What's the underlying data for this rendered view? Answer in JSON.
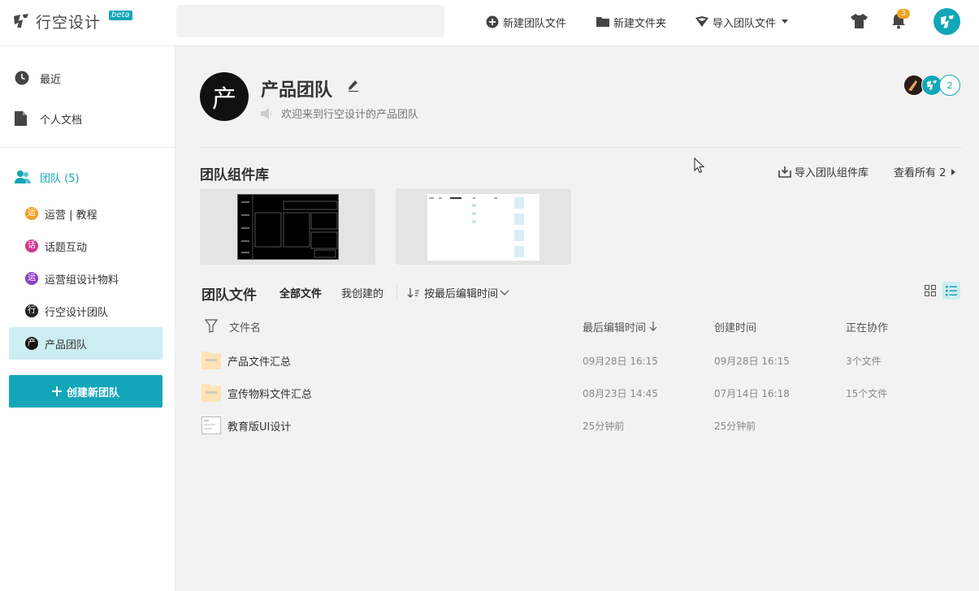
{
  "app": {
    "logo_text": "行空设计",
    "beta": "beta"
  },
  "search": {
    "placeholder": "",
    "value": ""
  },
  "toolbar": {
    "new_team_file": "新建团队文件",
    "new_folder": "新建文件夹",
    "import_team_file": "导入团队文件",
    "notification_count": "3",
    "icons": [
      "search-icon",
      "plus-circle-icon",
      "folder-icon",
      "import-icon",
      "caret-down-icon",
      "tshirt-icon",
      "bell-icon",
      "user-avatar"
    ]
  },
  "sidebar": {
    "recent": "最近",
    "personal_docs": "个人文档",
    "teams_header": "团队 (5)",
    "teams": [
      {
        "label": "运营 | 教程",
        "glyph": "运",
        "color": "#f0a221"
      },
      {
        "label": "话题互动",
        "glyph": "话",
        "color": "#d6358f"
      },
      {
        "label": "运营组设计物料",
        "glyph": "运",
        "color": "#8a3fc6"
      },
      {
        "label": "行空设计团队",
        "glyph": "行",
        "color": "#222222"
      },
      {
        "label": "产品团队",
        "glyph": "产",
        "color": "#111111"
      }
    ],
    "active_team_index": 4,
    "create_team": "创建新团队"
  },
  "team": {
    "avatar_glyph": "产",
    "name": "产品团队",
    "welcome": "欢迎来到行空设计的产品团队",
    "extra_members_count": "2"
  },
  "library": {
    "title": "团队组件库",
    "import_label": "导入团队组件库",
    "view_all_label": "查看所有 2"
  },
  "files": {
    "title": "团队文件",
    "tabs": [
      "全部文件",
      "我创建的"
    ],
    "active_tab": 0,
    "sort_label": "按最后编辑时间",
    "columns": {
      "name": "文件名",
      "last_edited": "最后编辑时间",
      "created": "创建时间",
      "collaborating": "正在协作"
    },
    "rows": [
      {
        "type": "folder",
        "name": "产品文件汇总",
        "last_edited": "09月28日 16:15",
        "created": "09月28日 16:15",
        "collab": "3个文件"
      },
      {
        "type": "folder",
        "name": "宣传物料文件汇总",
        "last_edited": "08月23日 14:45",
        "created": "07月14日 16:18",
        "collab": "15个文件"
      },
      {
        "type": "file",
        "name": "教育版UI设计",
        "last_edited": "25分钟前",
        "created": "25分钟前",
        "collab": ""
      }
    ]
  },
  "colors": {
    "accent": "#12a6b8",
    "accent_light": "#cdeef1",
    "badge": "#f0a221",
    "folder": "#fde3b5"
  }
}
